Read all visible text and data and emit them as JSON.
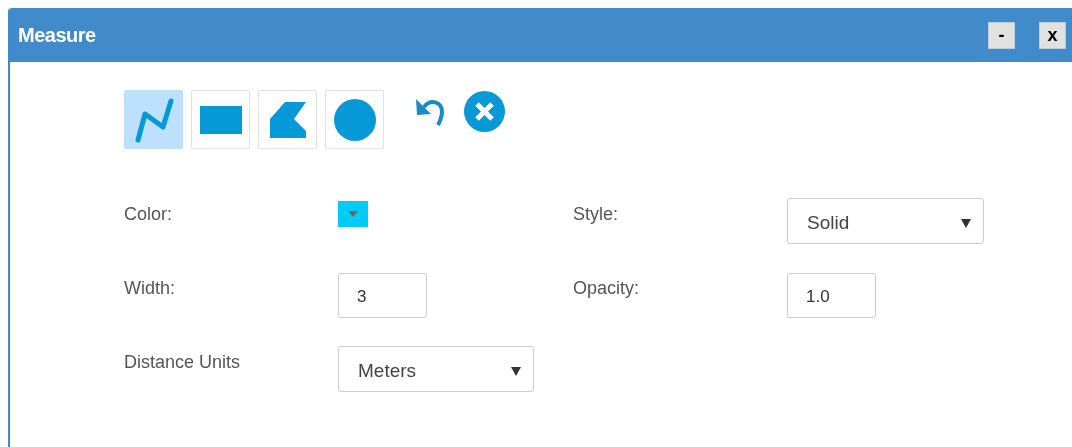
{
  "window": {
    "title": "Measure",
    "buttons": [
      "-",
      "x"
    ]
  },
  "tools": [
    {
      "kind": "polyline",
      "selected": true
    },
    {
      "kind": "rectangle",
      "selected": false
    },
    {
      "kind": "polygon",
      "selected": false
    },
    {
      "kind": "circle",
      "selected": false
    }
  ],
  "actions": [
    {
      "kind": "undo"
    },
    {
      "kind": "clear"
    }
  ],
  "fields": [
    {
      "kind": "color",
      "label": "Color:",
      "color": "#00ccf5"
    },
    {
      "kind": "select",
      "label": "Style:",
      "value": "Solid"
    },
    {
      "kind": "input",
      "label": "Width:",
      "value": "3"
    },
    {
      "kind": "input",
      "label": "Opacity:",
      "value": "1.0"
    },
    {
      "kind": "select",
      "label": "Distance Units",
      "value": "Meters"
    }
  ]
}
